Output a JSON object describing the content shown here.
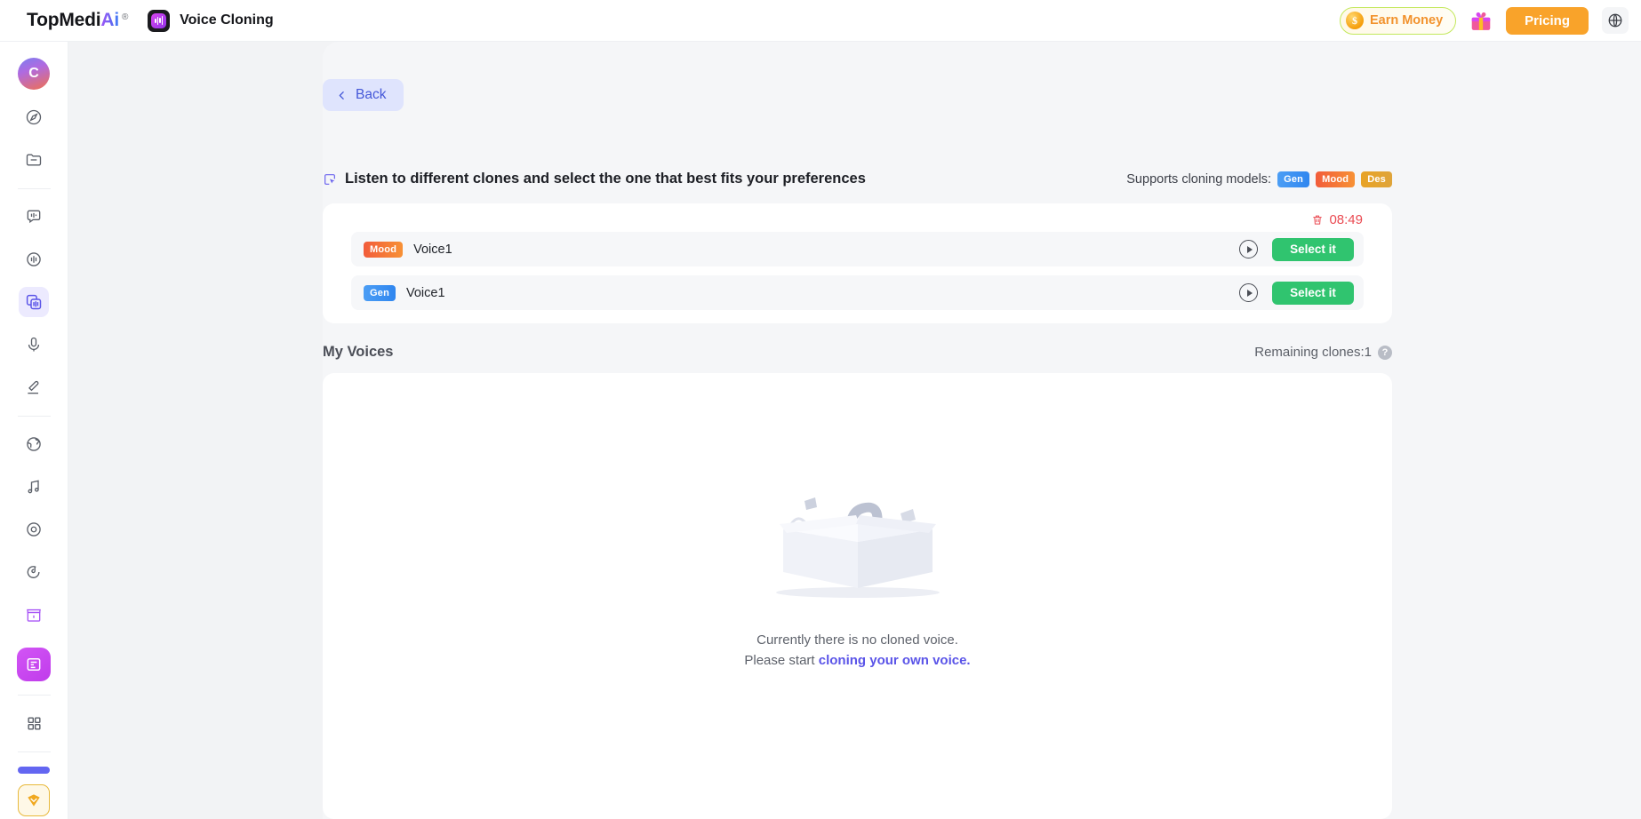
{
  "topbar": {
    "brand_main": "TopMedi",
    "brand_ai": "Ai",
    "brand_reg": "®",
    "app_name": "Voice Cloning",
    "earn_money_label": "Earn Money",
    "coin_symbol": "$",
    "pricing_label": "Pricing",
    "icons": {
      "gift": "gift-icon",
      "globe": "globe-icon"
    }
  },
  "sidebar": {
    "avatar_initial": "C",
    "items": [
      {
        "name": "discover-icon",
        "active": false
      },
      {
        "name": "folder-icon",
        "active": false
      },
      {
        "name": "text-to-speech-icon",
        "active": false
      },
      {
        "name": "voice-changer-icon",
        "active": false
      },
      {
        "name": "voice-cloning-icon",
        "active": true
      },
      {
        "name": "microphone-icon",
        "active": false
      },
      {
        "name": "speech-to-text-icon",
        "active": false
      },
      {
        "name": "translate-globe-icon",
        "active": false
      },
      {
        "name": "music-icon",
        "active": false
      },
      {
        "name": "record-icon",
        "active": false
      },
      {
        "name": "sound-effect-icon",
        "active": false
      },
      {
        "name": "store-icon",
        "active": false
      }
    ],
    "badge_icon": "ai-tools-icon",
    "apps_icon": "grid-apps-icon",
    "favorite_icon": "diamond-favorite-icon"
  },
  "main": {
    "back_label": "Back",
    "section_icon": "select-cursor-icon",
    "section_title": "Listen to different clones and select the one that best fits your preferences",
    "supports_label": "Supports cloning models:",
    "model_tags": [
      "Gen",
      "Mood",
      "Des"
    ],
    "expire_icon": "trash-icon",
    "expire_time": "08:49",
    "voices": [
      {
        "tag": "Mood",
        "tag_type": "mood",
        "name": "Voice1",
        "play": "play-icon",
        "select_label": "Select it"
      },
      {
        "tag": "Gen",
        "tag_type": "gen",
        "name": "Voice1",
        "play": "play-icon",
        "select_label": "Select it"
      }
    ],
    "my_voices_title": "My Voices",
    "remaining_label": "Remaining clones:1",
    "help_glyph": "?",
    "empty_line1": "Currently there is no cloned voice.",
    "empty_prefix": "Please start ",
    "empty_link": "cloning your own voice.",
    "empty_illustration": "empty-box-illustration"
  },
  "colors": {
    "accent_purple": "#5a54e8",
    "pricing_orange": "#f9a32a",
    "select_green": "#30c46f",
    "expire_red": "#ea4a52",
    "tag_gen": "#2f86ef",
    "tag_mood": "#f25c3b",
    "tag_des": "#dfa43a",
    "page_bg": "#f5f6f8"
  }
}
